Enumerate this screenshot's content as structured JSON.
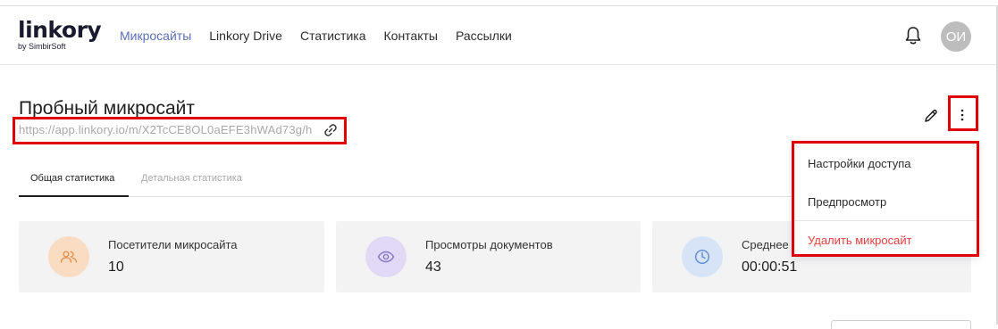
{
  "logo": {
    "main": "linkory",
    "sub": "by SimbirSoft"
  },
  "nav": {
    "items": [
      {
        "label": "Микросайты",
        "active": true
      },
      {
        "label": "Linkory Drive",
        "active": false
      },
      {
        "label": "Статистика",
        "active": false
      },
      {
        "label": "Контакты",
        "active": false
      },
      {
        "label": "Рассылки",
        "active": false
      }
    ]
  },
  "header": {
    "bell_icon": "bell-icon",
    "avatar_initials": "ОИ"
  },
  "page": {
    "title": "Пробный микросайт",
    "url": "https://app.linkory.io/m/X2TcCE8OL0aEFE3hWAd73g/h",
    "link_icon": "link-icon",
    "edit_icon": "pencil-icon",
    "more_icon": "more-vertical-icon"
  },
  "tabs": [
    {
      "label": "Общая статистика",
      "active": true
    },
    {
      "label": "Детальная статистика",
      "active": false
    }
  ],
  "stats": [
    {
      "label": "Посетители микросайта",
      "value": "10",
      "icon": "users-icon",
      "color": "#f9dcc2",
      "icon_color": "#e8954e"
    },
    {
      "label": "Просмотры документов",
      "value": "43",
      "icon": "eye-icon",
      "color": "#e2d9f6",
      "icon_color": "#8a78c8"
    },
    {
      "label": "Среднее",
      "value": "00:00:51",
      "icon": "clock-icon",
      "color": "#d7e4f7",
      "icon_color": "#5a8cd6"
    }
  ],
  "dropdown": {
    "items": [
      {
        "label": "Настройки доступа"
      },
      {
        "label": "Предпросмотр"
      },
      {
        "label": "Удалить микросайт",
        "danger": true
      }
    ]
  },
  "colors": {
    "accent": "#5b6fb5",
    "highlight": "#e00000",
    "danger": "#e24040"
  }
}
